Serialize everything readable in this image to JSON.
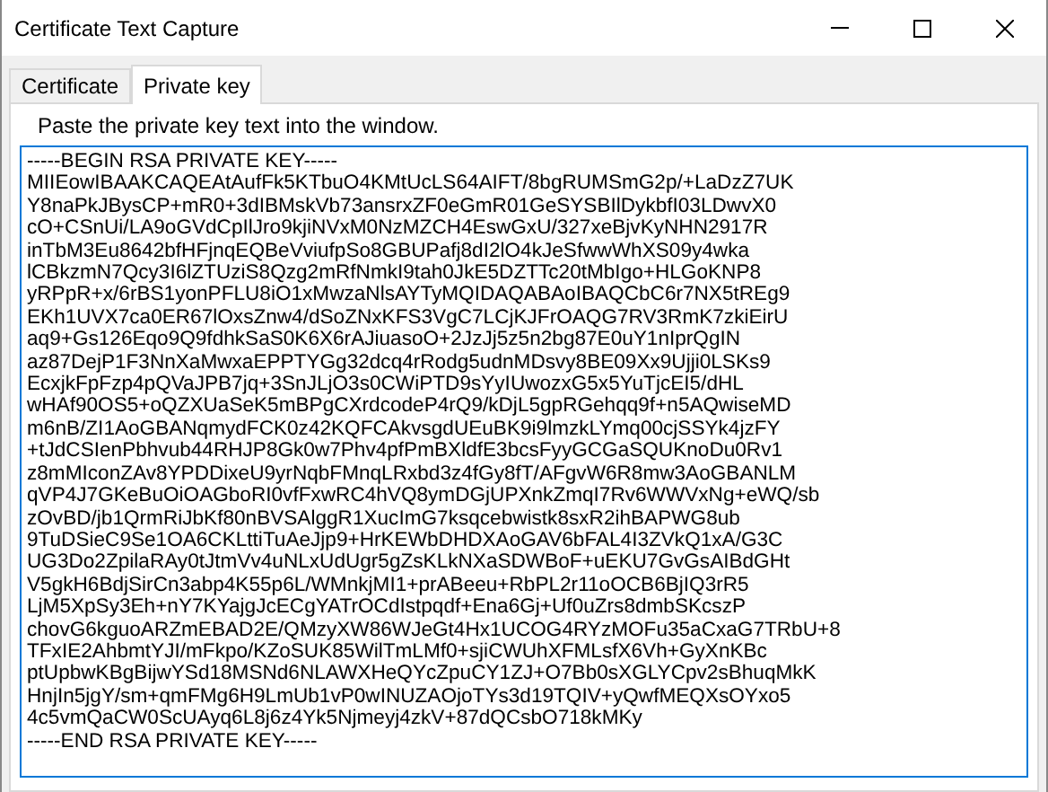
{
  "window": {
    "title": "Certificate Text Capture"
  },
  "tabs": [
    {
      "label": "Certificate",
      "selected": false
    },
    {
      "label": "Private key",
      "selected": true
    }
  ],
  "instruction": "Paste the private key text into the window.",
  "key_text": [
    "-----BEGIN RSA PRIVATE KEY-----",
    "MIIEowIBAAKCAQEAtAufFk5KTbuO4KMtUcLS64AIFT/8bgRUMSmG2p/+LaDzZ7UK",
    "Y8naPkJBysCP+mR0+3dIBMskVb73ansrxZF0eGmR01GeSYSBIlDykbfI03LDwvX0",
    "cO+CSnUi/LA9oGVdCpIlJro9kjiNVxM0NzMZCH4EswGxU/327xeBjvKyNHN2917R",
    "inTbM3Eu8642bfHFjnqEQBeVviufpSo8GBUPafj8dI2lO4kJeSfwwWhXS09y4wka",
    "lCBkzmN7Qcy3I6lZTUziS8Qzg2mRfNmkI9tah0JkE5DZTTc20tMbIgo+HLGoKNP8",
    "yRPpR+x/6rBS1yonPFLU8iO1xMwzaNlsAYTyMQIDAQABAoIBAQCbC6r7NX5tREg9",
    "EKh1UVX7ca0ER67lOxsZnw4/dSoZNxKFS3VgC7LCjKJFrOAQG7RV3RmK7zkiEirU",
    "aq9+Gs126Eqo9Q9fdhkSaS0K6X6rAJiuasoO+2JzJj5z5n2bg87E0uY1nIprQgIN",
    "az87DejP1F3NnXaMwxaEPPTYGg32dcq4rRodg5udnMDsvy8BE09Xx9Ujji0LSKs9",
    "EcxjkFpFzp4pQVaJPB7jq+3SnJLjO3s0CWiPTD9sYyIUwozxG5x5YuTjcEI5/dHL",
    "wHAf90OS5+oQZXUaSeK5mBPgCXrdcodeP4rQ9/kDjL5gpRGehqq9f+n5AQwiseMD",
    "m6nB/ZI1AoGBANqmydFCK0z42KQFCAkvsgdUEuBK9i9lmzkLYmq00cjSSYk4jzFY",
    "+tJdCSIenPbhvub44RHJP8Gk0w7Phv4pfPmBXldfE3bcsFyyGCGaSQUKnoDu0Rv1",
    "z8mMIconZAv8YPDDixeU9yrNqbFMnqLRxbd3z4fGy8fT/AFgvW6R8mw3AoGBANLM",
    "qVP4J7GKeBuOiOAGboRI0vfFxwRC4hVQ8ymDGjUPXnkZmqI7Rv6WWVxNg+eWQ/sb",
    "zOvBD/jb1QrmRiJbKf80nBVSAlggR1XucImG7ksqcebwistk8sxR2ihBAPWG8ub",
    "9TuDSieC9Se1OA6CKLttiTuAeJjp9+HrKEWbDHDXAoGAV6bFAL4I3ZVkQ1xA/G3C",
    "UG3Do2ZpilaRAy0tJtmVv4uNLxUdUgr5gZsKLkNXaSDWBoF+uEKU7GvGsAIBdGHt",
    "V5gkH6BdjSirCn3abp4K55p6L/WMnkjMI1+prABeeu+RbPL2r11oOCB6BjIQ3rR5",
    "LjM5XpSy3Eh+nY7KYajgJcECgYATrOCdIstpqdf+Ena6Gj+Uf0uZrs8dmbSKcszP",
    "chovG6kguoARZmEBAD2E/QMzyXW86WJeGt4Hx1UCOG4RYzMOFu35aCxaG7TRbU+8",
    "TFxIE2AhbmtYJI/mFkpo/KZoSUK85WilTmLMf0+sjiCWUhXFMLsfX6Vh+GyXnKBc",
    "ptUpbwKBgBijwYSd18MSNd6NLAWXHeQYcZpuCY1ZJ+O7Bb0sXGLYCpv2sBhuqMkK",
    "HnjIn5jgY/sm+qmFMg6H9LmUb1vP0wINUZAOjoTYs3d19TQIV+yQwfMEQXsOYxo5",
    "4c5vmQaCW0ScUAyq6L8j6z4Yk5Njmeyj4zkV+87dQCsbO718kMKy",
    "-----END RSA PRIVATE KEY-----"
  ]
}
